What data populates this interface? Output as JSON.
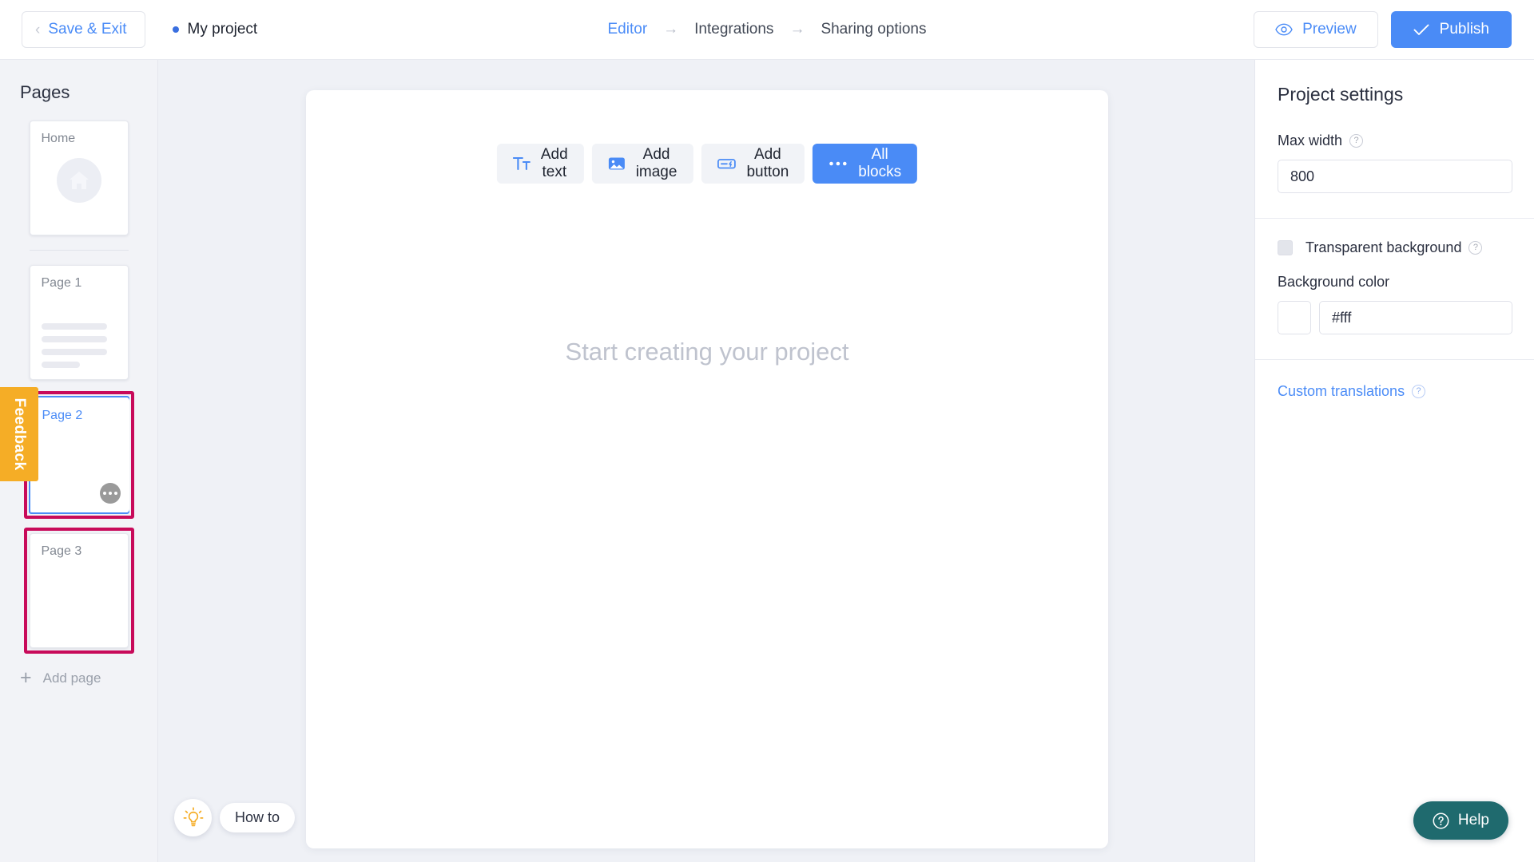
{
  "topbar": {
    "save_exit_label": "Save & Exit",
    "back_chevron_icon": "chevron-left-icon",
    "project_status_dot": "status-dot",
    "project_name": "My project",
    "breadcrumb": [
      {
        "label": "Editor",
        "active": true
      },
      {
        "label": "Integrations",
        "active": false
      },
      {
        "label": "Sharing options",
        "active": false
      }
    ],
    "breadcrumb_arrow": "→",
    "preview_label": "Preview",
    "preview_icon": "eye-icon",
    "publish_label": "Publish",
    "publish_icon": "check-icon",
    "accent_blue": "#4a8bf6"
  },
  "sidebar": {
    "title": "Pages",
    "pages": [
      {
        "label": "Home",
        "type": "home",
        "selected": false,
        "highlighted": false
      },
      {
        "label": "Page 1",
        "type": "content",
        "selected": false,
        "highlighted": false
      },
      {
        "label": "Page 2",
        "type": "blank",
        "selected": true,
        "highlighted": true
      },
      {
        "label": "Page 3",
        "type": "blank",
        "selected": false,
        "highlighted": true
      }
    ],
    "add_page_label": "Add page",
    "add_page_icon": "plus-icon",
    "page_menu_icon": "more-options-icon",
    "highlight_color": "#c80a5a",
    "selected_color": "#4b8cf7"
  },
  "feedback_tab": {
    "label": "Feedback",
    "color": "#f5ad26"
  },
  "canvas": {
    "toolbar": [
      {
        "label": "Add text",
        "icon": "add-text-icon",
        "primary": false
      },
      {
        "label": "Add image",
        "icon": "add-image-icon",
        "primary": false
      },
      {
        "label": "Add button",
        "icon": "add-button-icon",
        "primary": false
      },
      {
        "label": "All blocks",
        "icon": "ellipsis-icon",
        "primary": true
      }
    ],
    "placeholder": "Start creating your project"
  },
  "howto": {
    "label": "How to",
    "icon": "lightbulb-icon"
  },
  "settings": {
    "title": "Project settings",
    "max_width_label": "Max width",
    "max_width_value": "800",
    "max_width_help_icon": "question-mark-icon",
    "transparent_bg_label": "Transparent background",
    "transparent_bg_checked": false,
    "transparent_bg_help_icon": "question-mark-icon",
    "background_color_label": "Background color",
    "background_color_value": "#fff",
    "background_color_swatch": "#ffffff",
    "custom_translations_label": "Custom translations",
    "custom_translations_help_icon": "question-mark-icon"
  },
  "help": {
    "label": "Help",
    "icon": "help-circle-icon",
    "color": "#1f6a6e"
  }
}
